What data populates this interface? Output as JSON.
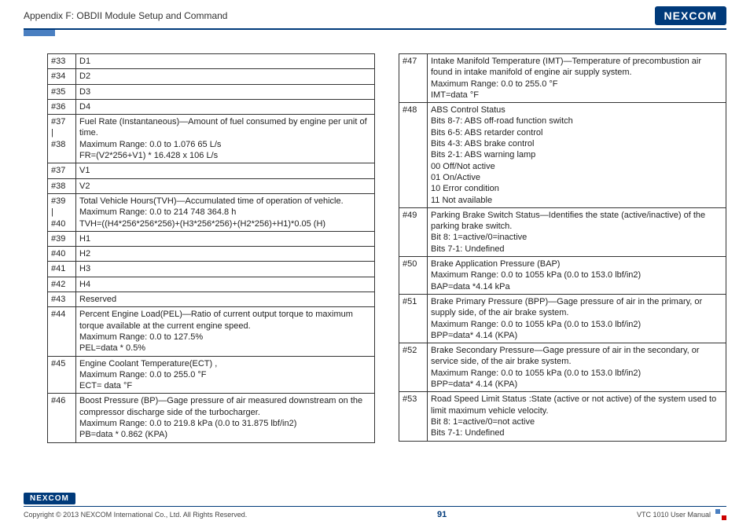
{
  "header": {
    "title": "Appendix F: OBDII Module Setup and Command",
    "logo": "NEXCOM"
  },
  "left": [
    {
      "idx": "#33",
      "desc": "D1"
    },
    {
      "idx": "#34",
      "desc": "D2"
    },
    {
      "idx": "#35",
      "desc": "D3"
    },
    {
      "idx": "#36",
      "desc": "D4"
    },
    {
      "idx": "#37\n|\n#38",
      "desc": "Fuel Rate (Instantaneous)—Amount of fuel consumed by engine per unit of time.\nMaximum Range: 0.0 to 1.076 65 L/s\nFR=(V2*256+V1) * 16.428 x 106 L/s"
    },
    {
      "idx": "#37",
      "desc": "V1"
    },
    {
      "idx": "#38",
      "desc": "V2"
    },
    {
      "idx": "#39\n|\n#40",
      "desc": "Total Vehicle Hours(TVH)—Accumulated time of operation of vehicle.\nMaximum Range: 0.0 to 214 748 364.8 h\nTVH=((H4*256*256*256)+(H3*256*256)+(H2*256)+H1)*0.05 (H)"
    },
    {
      "idx": "#39",
      "desc": "H1"
    },
    {
      "idx": "#40",
      "desc": "H2"
    },
    {
      "idx": "#41",
      "desc": "H3"
    },
    {
      "idx": "#42",
      "desc": "H4"
    },
    {
      "idx": "#43",
      "desc": "Reserved"
    },
    {
      "idx": "#44",
      "desc": "Percent Engine Load(PEL)—Ratio of current output torque to maximum torque available at the current engine speed.\nMaximum Range: 0.0 to 127.5%\nPEL=data * 0.5%"
    },
    {
      "idx": "#45",
      "desc": "Engine Coolant Temperature(ECT) ,\nMaximum Range: 0.0 to 255.0 °F\nECT= data °F"
    },
    {
      "idx": "#46",
      "desc": "Boost Pressure (BP)—Gage pressure of air measured downstream on the compressor discharge side of the turbocharger.\nMaximum Range: 0.0 to 219.8 kPa (0.0 to 31.875 lbf/in2)\nPB=data * 0.862 (KPA)"
    }
  ],
  "right": [
    {
      "idx": "#47",
      "desc": "Intake Manifold Temperature (IMT)—Temperature of precombustion air found in intake manifold of engine air supply system.\nMaximum Range: 0.0 to 255.0 °F\nIMT=data °F"
    },
    {
      "idx": "#48",
      "desc": "ABS Control Status\nBits 8-7: ABS off-road function switch\nBits 6-5: ABS retarder control\nBits 4-3: ABS brake control\nBits 2-1: ABS warning lamp\n00 Off/Not active\n01 On/Active\n10 Error condition\n11 Not available"
    },
    {
      "idx": "#49",
      "desc": "Parking Brake Switch Status—Identifies the state (active/inactive) of the parking brake switch.\nBit 8: 1=active/0=inactive\nBits 7-1: Undefined"
    },
    {
      "idx": "#50",
      "desc": "Brake Application Pressure (BAP)\nMaximum Range: 0.0 to 1055 kPa (0.0 to 153.0 lbf/in2)\nBAP=data *4.14 kPa"
    },
    {
      "idx": "#51",
      "desc": "Brake Primary Pressure (BPP)—Gage pressure of air in the primary, or supply side, of the air brake system.\nMaximum Range: 0.0 to 1055 kPa (0.0 to 153.0 lbf/in2)\nBPP=data* 4.14 (KPA)"
    },
    {
      "idx": "#52",
      "desc": "Brake Secondary Pressure—Gage pressure of air in the secondary, or service side, of the air brake system.\nMaximum Range: 0.0 to 1055 kPa (0.0 to 153.0 lbf/in2)\nBPP=data* 4.14 (KPA)"
    },
    {
      "idx": "#53",
      "desc": "Road Speed Limit Status :State (active or not active) of the system used to limit maximum vehicle velocity.\nBit 8: 1=active/0=not active\nBits 7-1: Undefined"
    }
  ],
  "footer": {
    "logo": "NEXCOM",
    "copyright": "Copyright © 2013 NEXCOM International Co., Ltd. All Rights Reserved.",
    "page": "91",
    "manual": "VTC 1010 User Manual"
  }
}
